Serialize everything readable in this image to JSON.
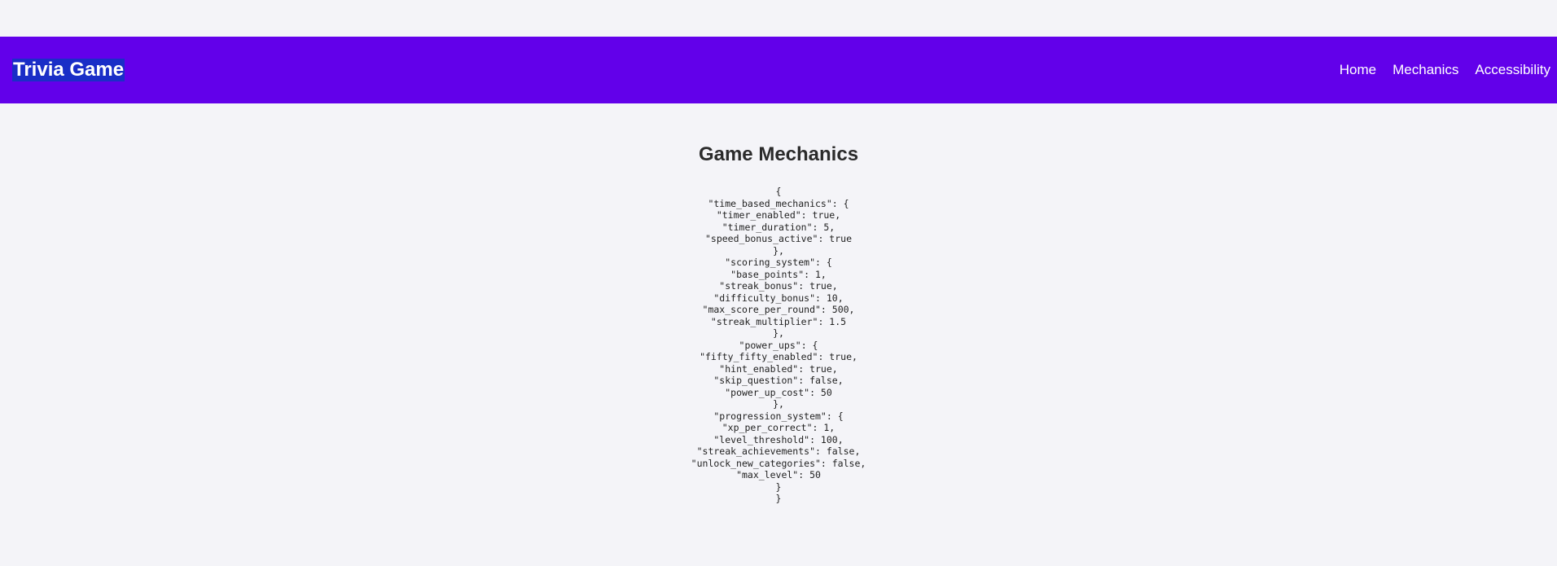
{
  "header": {
    "title": "Trivia Game",
    "nav": [
      "Home",
      "Mechanics",
      "Accessibility"
    ]
  },
  "main": {
    "heading": "Game Mechanics",
    "code_lines": [
      "{",
      "\"time_based_mechanics\": {",
      "\"timer_enabled\": true,",
      "\"timer_duration\": 5,",
      "\"speed_bonus_active\": true",
      "},",
      "\"scoring_system\": {",
      "\"base_points\": 1,",
      "\"streak_bonus\": true,",
      "\"difficulty_bonus\": 10,",
      "\"max_score_per_round\": 500,",
      "\"streak_multiplier\": 1.5",
      "},",
      "\"power_ups\": {",
      "\"fifty_fifty_enabled\": true,",
      "\"hint_enabled\": true,",
      "\"skip_question\": false,",
      "\"power_up_cost\": 50",
      "},",
      "\"progression_system\": {",
      "\"xp_per_correct\": 1,",
      "\"level_threshold\": 100,",
      "\"streak_achievements\": false,",
      "\"unlock_new_categories\": false,",
      "\"max_level\": 50",
      "}",
      "}"
    ]
  }
}
